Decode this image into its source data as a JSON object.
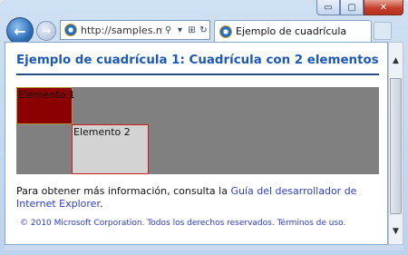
{
  "window": {
    "controls": {
      "minimize": "▭",
      "maximize": "▢",
      "close": "✕"
    }
  },
  "nav": {
    "back_icon": "←",
    "forward_icon": "→"
  },
  "addressbar": {
    "url": "http://samples.m...",
    "search_icon": "⚲",
    "dropdown_icon": "▾",
    "compat_icon": "⊞",
    "refresh_icon": "↻"
  },
  "tab": {
    "title": "Ejemplo de cuadrícula"
  },
  "page": {
    "heading": "Ejemplo de cuadrícula 1: Cuadrícula con 2 elementos",
    "element1": "Elemento 1",
    "element2": "Elemento 2",
    "info_prefix": "Para obtener más información, consulta la ",
    "info_link": "Guía del desarrollador de Internet Explorer",
    "info_suffix": ".",
    "copyright": "© 2010 Microsoft Corporation. Todos los derechos reservados. ",
    "terms_link": "Términos de uso",
    "terms_suffix": "."
  },
  "scrollbar": {
    "up_icon": "▲",
    "down_icon": "▼"
  },
  "colors": {
    "heading": "#1d58b5",
    "grid_bg": "#808080",
    "element1_bg": "#8b0000",
    "element2_bg": "#d3d3d3",
    "link": "#2b3dc8"
  }
}
